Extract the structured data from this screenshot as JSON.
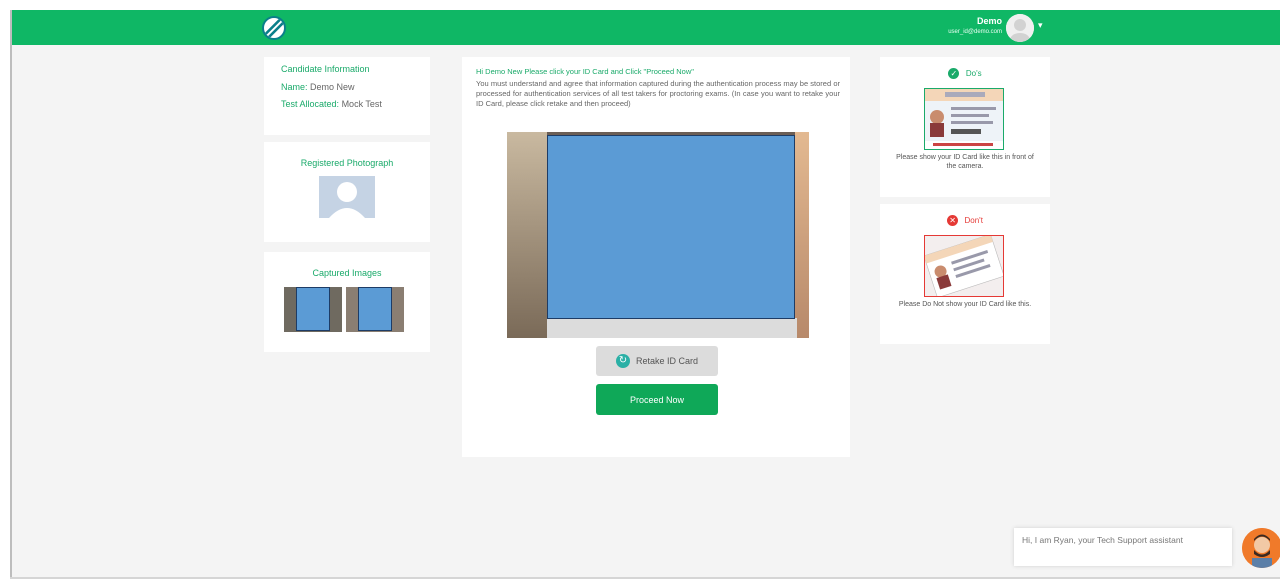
{
  "header": {
    "user_name": "Demo",
    "user_email": "user_id@demo.com",
    "logo_icon": "brand-logo-icon",
    "avatar_icon": "user-avatar-icon",
    "menu_icon": "caret-down-icon"
  },
  "candidate": {
    "heading": "Candidate Information",
    "name_label": "Name:",
    "name_value": "Demo New",
    "test_label": "Test Allocated:",
    "test_value": "Mock Test"
  },
  "registered_photo": {
    "heading": "Registered Photograph"
  },
  "captured_images": {
    "heading": "Captured Images"
  },
  "instructions": {
    "title": "Hi Demo New Please click your ID Card and Click \"Proceed Now\"",
    "paragraph": "You must understand and agree that information captured during the authentication process may be stored or processed for authentication services of all test takers for proctoring exams. (In case you want to retake your ID Card, please click retake and then proceed)"
  },
  "actions": {
    "retake_label": "Retake ID Card",
    "proceed_label": "Proceed Now"
  },
  "do_card": {
    "label": "Do's",
    "caption": "Please show your ID Card like this in front of the camera."
  },
  "dont_card": {
    "label": "Don't",
    "caption": "Please Do Not show your ID Card like this."
  },
  "chat": {
    "message": "Hi, I am Ryan, your Tech Support assistant"
  },
  "colors": {
    "brand_green": "#0fb765",
    "button_green": "#0fa858",
    "accent_text": "#1aaa6a",
    "redaction_blue": "#5b9bd5",
    "dont_red": "#e53935"
  }
}
